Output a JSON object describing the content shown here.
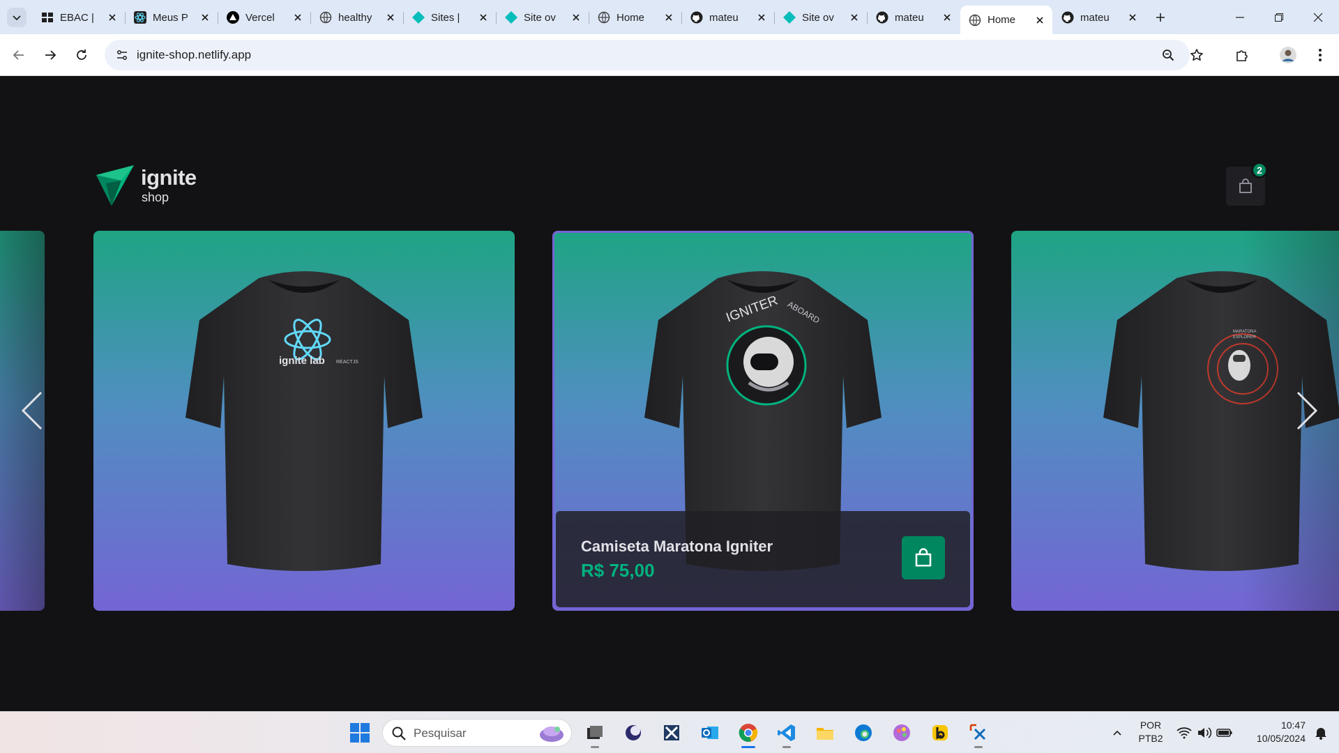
{
  "browser": {
    "tabs": [
      {
        "label": "EBAC | ",
        "icon": "ebac-icon"
      },
      {
        "label": "Meus P",
        "icon": "react-icon"
      },
      {
        "label": "Vercel",
        "icon": "vercel-icon"
      },
      {
        "label": "healthy",
        "icon": "globe-icon"
      },
      {
        "label": "Sites | ",
        "icon": "netlify-icon"
      },
      {
        "label": "Site ov",
        "icon": "netlify-icon"
      },
      {
        "label": "Home",
        "icon": "globe-icon"
      },
      {
        "label": "mateu",
        "icon": "github-icon"
      },
      {
        "label": "Site ov",
        "icon": "netlify-icon"
      },
      {
        "label": "mateu",
        "icon": "github-icon"
      },
      {
        "label": "Home",
        "icon": "globe-icon",
        "active": true
      },
      {
        "label": "mateu",
        "icon": "github-icon"
      }
    ],
    "url": "ignite-shop.netlify.app"
  },
  "header": {
    "logo_title": "ignite",
    "logo_subtitle": "shop",
    "cart_count": "2"
  },
  "products": [
    {
      "name": "",
      "price": "",
      "print": "partial"
    },
    {
      "name": "",
      "price": "",
      "print": "ignite-lab"
    },
    {
      "name": "Camiseta Maratona Igniter",
      "price": "R$ 75,00",
      "print": "igniter-aboard",
      "hovered": true
    },
    {
      "name": "",
      "price": "",
      "print": "maratona-explorer"
    }
  ],
  "print_text": {
    "ignite_lab": "ignite lab",
    "reactjs": "REACTJS",
    "igniter": "IGNITER",
    "aboard": "ABOARD",
    "maratona": "MARATONA",
    "explorer": "EXPLORER"
  },
  "taskbar": {
    "search_placeholder": "Pesquisar",
    "apps": [
      "task-view-icon",
      "app-icon",
      "capcut-icon",
      "outlook-icon",
      "chrome-icon",
      "vscode-icon",
      "file-explorer-icon",
      "edge-icon",
      "paint-icon",
      "bing-icon",
      "snipping-tool-icon"
    ],
    "lang_line1": "POR",
    "lang_line2": "PTB2",
    "time": "10:47",
    "date": "10/05/2024"
  },
  "colors": {
    "accent_green": "#00875f",
    "price_green": "#00b37e",
    "page_bg": "#121214",
    "card_gradient_top": "#1ea483",
    "card_gradient_bottom": "#7465d4"
  }
}
